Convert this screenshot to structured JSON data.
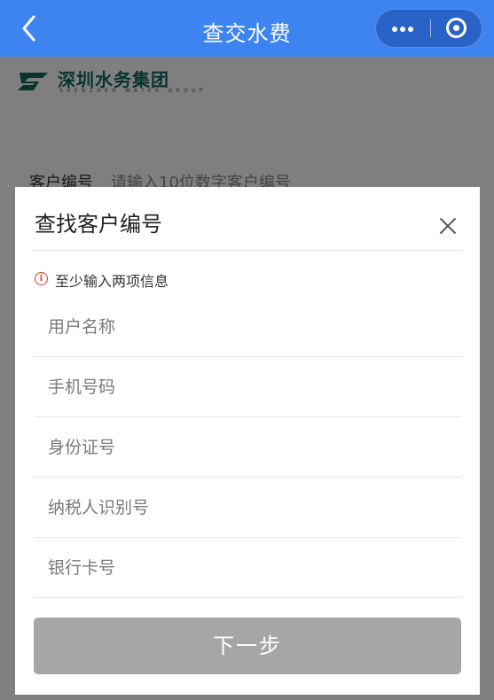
{
  "nav": {
    "title": "查交水费",
    "brand_color": "#3d84f1"
  },
  "brand": {
    "name_cn": "深圳水务集团",
    "name_en": "SHENZHEN WATER GROUP",
    "color": "#0e6a5a"
  },
  "form": {
    "label": "客户编号",
    "placeholder": "请输入10位数字客户编号"
  },
  "sheet": {
    "title": "查找客户编号",
    "warning_text": "至少输入两项信息",
    "warning_icon": "info-circle-icon",
    "fields": [
      {
        "placeholder": "用户名称",
        "value": ""
      },
      {
        "placeholder": "手机号码",
        "value": ""
      },
      {
        "placeholder": "身份证号",
        "value": ""
      },
      {
        "placeholder": "纳税人识别号",
        "value": ""
      },
      {
        "placeholder": "银行卡号",
        "value": ""
      }
    ],
    "next_label": "下一步",
    "next_color": "#a6a6a6",
    "warning_color": "#d63a2e"
  }
}
